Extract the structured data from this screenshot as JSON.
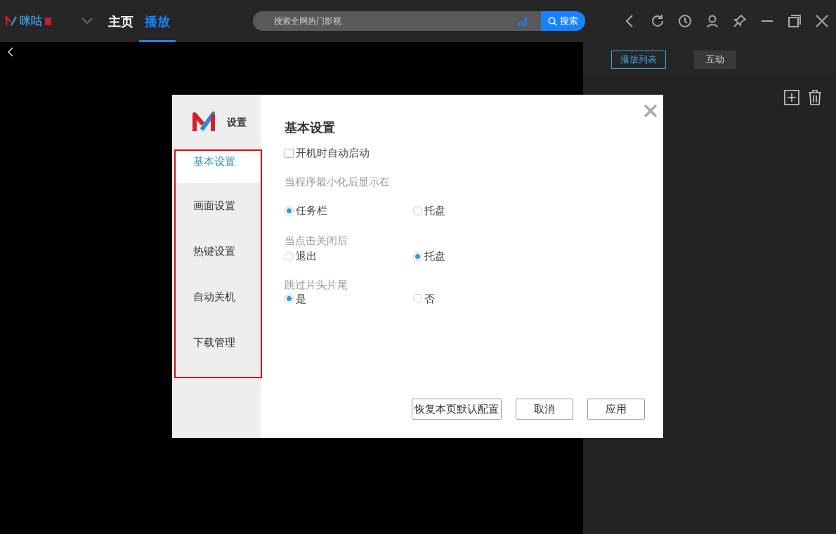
{
  "app": {
    "logo": "咪咕",
    "nav_tabs": [
      {
        "label": "主页",
        "selected": false
      },
      {
        "label": "播放",
        "selected": true
      }
    ],
    "search": {
      "placeholder": "搜索全网热门影视",
      "button": "搜索"
    }
  },
  "side_panel": {
    "tabs": [
      {
        "label": "播放列表",
        "selected": true
      },
      {
        "label": "互动",
        "selected": false
      }
    ]
  },
  "settings_dialog": {
    "title": "设置",
    "nav": [
      {
        "label": "基本设置",
        "selected": true
      },
      {
        "label": "画面设置",
        "selected": false
      },
      {
        "label": "热键设置",
        "selected": false
      },
      {
        "label": "自动关机",
        "selected": false
      },
      {
        "label": "下载管理",
        "selected": false
      }
    ],
    "section_title": "基本设置",
    "autostart": {
      "label": "开机时自动启动",
      "checked": false
    },
    "groups": [
      {
        "label": "当程序最小化后显示在",
        "options": [
          {
            "label": "任务栏",
            "selected": true
          },
          {
            "label": "托盘",
            "selected": false
          }
        ]
      },
      {
        "label": "当点击关闭后",
        "options": [
          {
            "label": "退出",
            "selected": false
          },
          {
            "label": "托盘",
            "selected": true
          }
        ]
      },
      {
        "label": "跳过片头片尾",
        "options": [
          {
            "label": "是",
            "selected": true
          },
          {
            "label": "否",
            "selected": false
          }
        ]
      }
    ],
    "buttons": [
      "恢复本页默认配置",
      "取消",
      "应用"
    ]
  }
}
